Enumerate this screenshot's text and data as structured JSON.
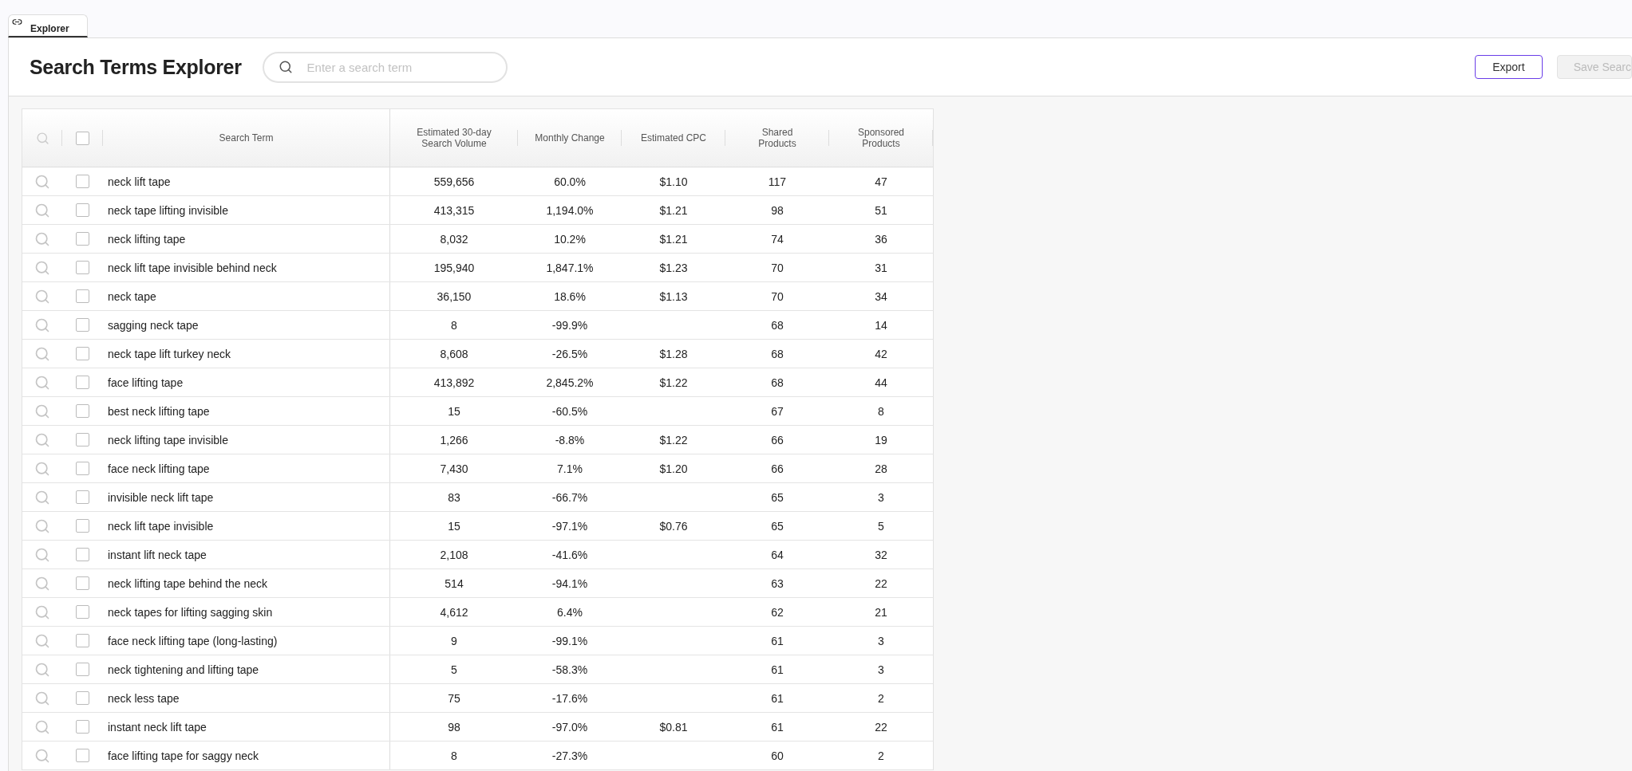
{
  "tabs": [
    {
      "label": "Explorer",
      "selected": true
    }
  ],
  "header": {
    "title": "Search Terms Explorer",
    "search": {
      "placeholder": "Enter a search term"
    },
    "buttons": [
      {
        "label": "Export",
        "disabled": false
      },
      {
        "label": "Save Searc",
        "disabled": true
      }
    ]
  },
  "table": {
    "select_all": {
      "checked": false
    },
    "columns": [
      "Search Term",
      "Estimated 30-day Search Volume",
      "Monthly Change",
      "Estimated CPC",
      "Shared Products",
      "Sponsored Products"
    ],
    "rows": [
      {
        "checked": false,
        "cells": [
          "neck lift tape",
          "559,656",
          "60.0%",
          "$1.10",
          "117",
          "47"
        ]
      },
      {
        "checked": false,
        "cells": [
          "neck tape lifting invisible",
          "413,315",
          "1,194.0%",
          "$1.21",
          "98",
          "51"
        ]
      },
      {
        "checked": false,
        "cells": [
          "neck lifting tape",
          "8,032",
          "10.2%",
          "$1.21",
          "74",
          "36"
        ]
      },
      {
        "checked": false,
        "cells": [
          "neck lift tape invisible behind neck",
          "195,940",
          "1,847.1%",
          "$1.23",
          "70",
          "31"
        ]
      },
      {
        "checked": false,
        "cells": [
          "neck tape",
          "36,150",
          "18.6%",
          "$1.13",
          "70",
          "34"
        ]
      },
      {
        "checked": false,
        "cells": [
          "sagging neck tape",
          "8",
          "-99.9%",
          "",
          "68",
          "14"
        ]
      },
      {
        "checked": false,
        "cells": [
          "neck tape lift turkey neck",
          "8,608",
          "-26.5%",
          "$1.28",
          "68",
          "42"
        ]
      },
      {
        "checked": false,
        "cells": [
          "face lifting tape",
          "413,892",
          "2,845.2%",
          "$1.22",
          "68",
          "44"
        ]
      },
      {
        "checked": false,
        "cells": [
          "best neck lifting tape",
          "15",
          "-60.5%",
          "",
          "67",
          "8"
        ]
      },
      {
        "checked": false,
        "cells": [
          "neck lifting tape invisible",
          "1,266",
          "-8.8%",
          "$1.22",
          "66",
          "19"
        ]
      },
      {
        "checked": false,
        "cells": [
          "face neck lifting tape",
          "7,430",
          "7.1%",
          "$1.20",
          "66",
          "28"
        ]
      },
      {
        "checked": false,
        "cells": [
          "invisible neck lift tape",
          "83",
          "-66.7%",
          "",
          "65",
          "3"
        ]
      },
      {
        "checked": false,
        "cells": [
          "neck lift tape invisible",
          "15",
          "-97.1%",
          "$0.76",
          "65",
          "5"
        ]
      },
      {
        "checked": false,
        "cells": [
          "instant lift neck tape",
          "2,108",
          "-41.6%",
          "",
          "64",
          "32"
        ]
      },
      {
        "checked": false,
        "cells": [
          "neck lifting tape behind the neck",
          "514",
          "-94.1%",
          "",
          "63",
          "22"
        ]
      },
      {
        "checked": false,
        "cells": [
          "neck tapes for lifting sagging skin",
          "4,612",
          "6.4%",
          "",
          "62",
          "21"
        ]
      },
      {
        "checked": false,
        "cells": [
          "face neck lifting tape (long-lasting)",
          "9",
          "-99.1%",
          "",
          "61",
          "3"
        ]
      },
      {
        "checked": false,
        "cells": [
          "neck tightening and lifting tape",
          "5",
          "-58.3%",
          "",
          "61",
          "3"
        ]
      },
      {
        "checked": false,
        "cells": [
          "neck less tape",
          "75",
          "-17.6%",
          "",
          "61",
          "2"
        ]
      },
      {
        "checked": false,
        "cells": [
          "instant neck lift tape",
          "98",
          "-97.0%",
          "$0.81",
          "61",
          "22"
        ]
      },
      {
        "checked": false,
        "cells": [
          "face lifting tape for saggy neck",
          "8",
          "-27.3%",
          "",
          "60",
          "2"
        ]
      }
    ]
  }
}
